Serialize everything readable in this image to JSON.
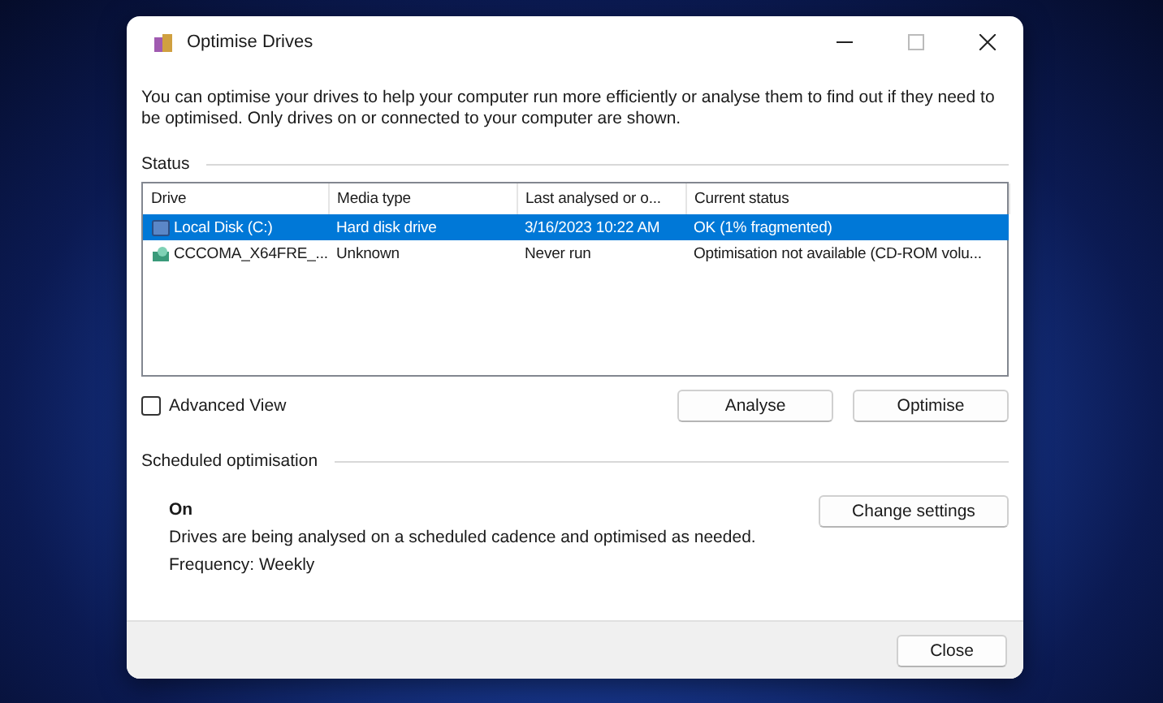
{
  "window": {
    "title": "Optimise Drives"
  },
  "description": "You can optimise your drives to help your computer run more efficiently or analyse them to find out if they need to be optimised. Only drives on or connected to your computer are shown.",
  "status": {
    "heading": "Status",
    "columns": [
      "Drive",
      "Media type",
      "Last analysed or o...",
      "Current status"
    ],
    "rows": [
      {
        "kind": "disk",
        "drive": "Local Disk  (C:)",
        "media_type": "Hard disk drive",
        "last_analysed": "3/16/2023 10:22 AM",
        "current_status": "OK (1% fragmented)",
        "selected": true
      },
      {
        "kind": "cdrom",
        "drive": "CCCOMA_X64FRE_...",
        "media_type": "Unknown",
        "last_analysed": "Never run",
        "current_status": "Optimisation not available (CD-ROM volu...",
        "selected": false
      }
    ],
    "advanced_view": {
      "label": "Advanced View",
      "checked": false
    },
    "buttons": [
      "Analyse",
      "Optimise"
    ]
  },
  "scheduled": {
    "heading": "Scheduled optimisation",
    "state": "On",
    "text": "Drives are being analysed on a scheduled cadence and optimised as needed.",
    "frequency": "Frequency: Weekly",
    "button": "Change settings"
  },
  "footer": {
    "button": "Close"
  }
}
